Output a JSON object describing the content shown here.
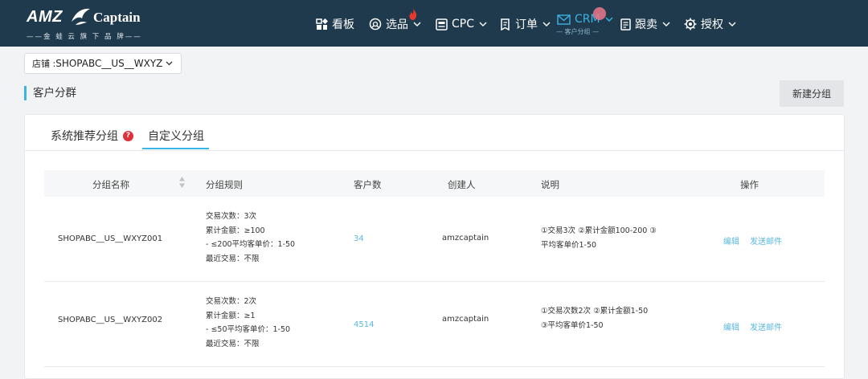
{
  "brand": {
    "logo_text": "AMZ",
    "logo_word": "Captain",
    "tagline": "——金 蛙 云 旗 下 品 牌——"
  },
  "nav": {
    "items": [
      {
        "label": "看板",
        "icon": "dashboard-icon"
      },
      {
        "label": "选品",
        "icon": "product-select-icon",
        "badge": "flame-icon"
      },
      {
        "label": "CPC",
        "icon": "cpc-icon"
      },
      {
        "label": "订单",
        "icon": "order-icon"
      },
      {
        "label": "CRM",
        "icon": "mail-icon",
        "sub": "— 客户分组 —",
        "active": true
      },
      {
        "label": "跟卖",
        "icon": "follow-sell-icon"
      },
      {
        "label": "授权",
        "icon": "authorize-icon"
      }
    ]
  },
  "shop_selector": {
    "label": "店铺 :",
    "value": "SHOPABC__US__WXYZ"
  },
  "page": {
    "title": "客户分群",
    "new_group_button": "新建分组"
  },
  "tabs": [
    {
      "label": "系统推荐分组",
      "help": "?",
      "active": false
    },
    {
      "label": "自定义分组",
      "active": true
    }
  ],
  "table": {
    "columns": [
      "分组名称",
      "分组规则",
      "客户数",
      "创建人",
      "说明",
      "操作"
    ],
    "rows": [
      {
        "name": "SHOPABC__US__WXYZ001",
        "rules": [
          "交易次数：3次",
          "累计金额：≥100",
          "- ≤200平均客单价：1-50",
          "最近交易：不限"
        ],
        "count": "34",
        "creator": "amzcaptain",
        "desc": [
          "①交易3次 ②累计金额100-200 ③",
          "平均客单价1-50"
        ],
        "actions": [
          "编辑",
          "发送邮件"
        ]
      },
      {
        "name": "SHOPABC__US__WXYZ002",
        "rules": [
          "交易次数：2次",
          "累计金额：≥1",
          "- ≤50平均客单价：1-50",
          "最近交易：不限"
        ],
        "count": "4514",
        "creator": "amzcaptain",
        "desc": [
          "①交易次数2次 ②累计金额1-50",
          "③平均客单价1-50"
        ],
        "actions": [
          "编辑",
          "发送邮件"
        ]
      }
    ]
  },
  "colors": {
    "topbar": "#1f3a4d",
    "accent": "#3bb4e6",
    "link": "#5ab8df",
    "help_badge": "#e0303a"
  }
}
